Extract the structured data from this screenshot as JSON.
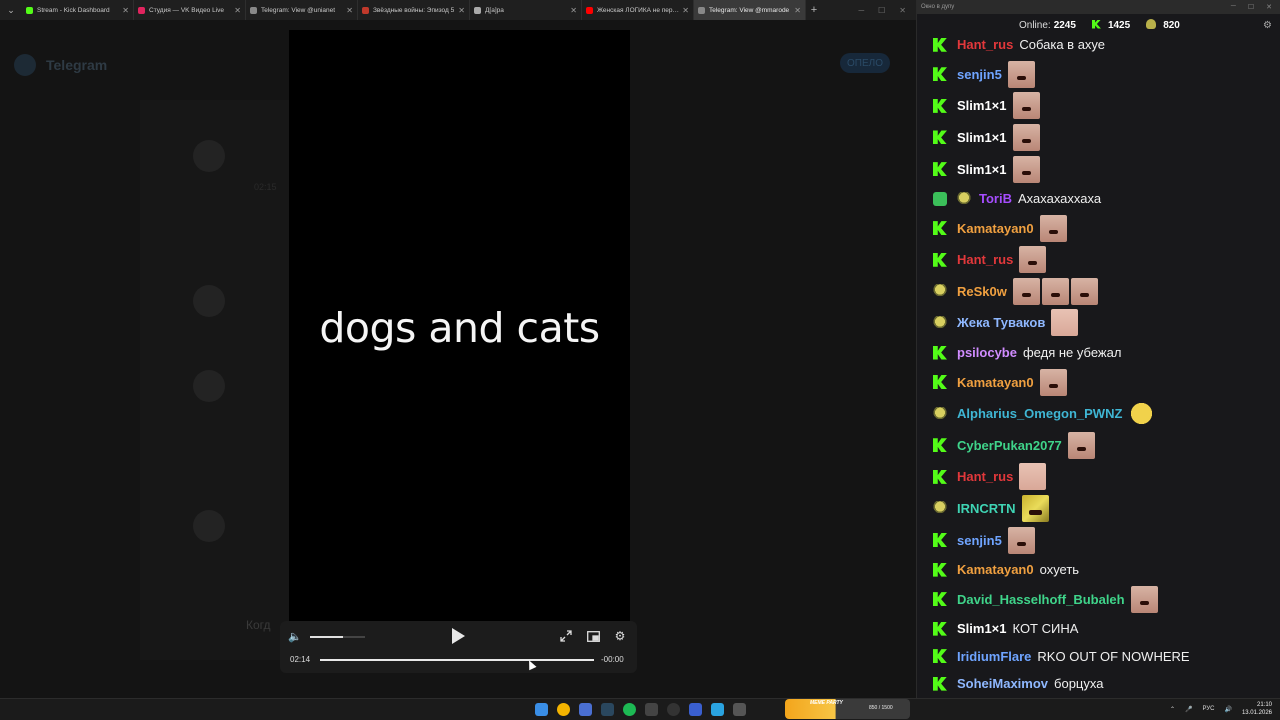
{
  "browser": {
    "tabs": [
      {
        "label": "Stream - Kick Dashboard",
        "color": "#53fc18",
        "active": false
      },
      {
        "label": "Студия — VK Видео Live",
        "color": "#e0245e",
        "active": false
      },
      {
        "label": "Telegram: View @unianet",
        "color": "#888888",
        "active": false
      },
      {
        "label": "Звёздные войны: Эпизод 5",
        "color": "#c0392b",
        "active": false
      },
      {
        "label": "Д[а]ра",
        "color": "#aaaaaa",
        "active": false
      },
      {
        "label": "Женская ЛОГИКА не перес",
        "color": "#ff0000",
        "active": false
      },
      {
        "label": "Telegram: View @mmarode",
        "color": "#888888",
        "active": true
      }
    ],
    "page_header": "Telegram",
    "page_button": "ОПЕЛО",
    "page_snippet": "02:15",
    "page_caption": "Когд"
  },
  "video": {
    "title_text": "dogs and cats",
    "current_time": "02:14",
    "remaining_time": "-00:00",
    "volume_level": 0.6,
    "progress": 1.0
  },
  "chat": {
    "window_title": "Окно в дупу",
    "online_label": "Online:",
    "online_count": "2245",
    "followers_count": "1425",
    "subs_count": "820",
    "messages": [
      {
        "badge": "k",
        "user": "Hant_rus",
        "color": "#e2383b",
        "text": "Собака в ахуе",
        "emotes": []
      },
      {
        "badge": "k",
        "user": "senjin5",
        "color": "#6fa4ff",
        "text": "",
        "emotes": [
          "face"
        ]
      },
      {
        "badge": "k",
        "user": "Slim1×1",
        "color": "#ffffff",
        "text": "",
        "emotes": [
          "face"
        ]
      },
      {
        "badge": "k",
        "user": "Slim1×1",
        "color": "#ffffff",
        "text": "",
        "emotes": [
          "face"
        ]
      },
      {
        "badge": "k",
        "user": "Slim1×1",
        "color": "#ffffff",
        "text": "",
        "emotes": [
          "face"
        ]
      },
      {
        "badge": "g",
        "badge2": true,
        "user": "ToriB",
        "color": "#a64dff",
        "text": "Ахахахаххаха",
        "emotes": []
      },
      {
        "badge": "k",
        "user": "Kamatayan0",
        "color": "#f0a040",
        "text": "",
        "emotes": [
          "face"
        ]
      },
      {
        "badge": "k",
        "user": "Hant_rus",
        "color": "#e2383b",
        "text": "",
        "emotes": [
          "face"
        ]
      },
      {
        "badge": "s",
        "user": "ReSk0w",
        "color": "#f0a040",
        "text": "",
        "emotes": [
          "face",
          "face",
          "face"
        ]
      },
      {
        "badge": "s",
        "user": "Жека Туваков",
        "color": "#8fb8ff",
        "text": "",
        "emotes": [
          "pale"
        ]
      },
      {
        "badge": "k",
        "user": "psilocybe",
        "color": "#d08cff",
        "text": "федя не убежал",
        "emotes": []
      },
      {
        "badge": "k",
        "user": "Kamatayan0",
        "color": "#f0a040",
        "text": "",
        "emotes": [
          "face"
        ]
      },
      {
        "badge": "s",
        "user": "Alpharius_Omegon_PWNZ",
        "color": "#3fb6d4",
        "text": "",
        "emotes": [
          "ball"
        ]
      },
      {
        "badge": "k",
        "user": "CyberPukan2077",
        "color": "#3fd48a",
        "text": "",
        "emotes": [
          "face"
        ]
      },
      {
        "badge": "k",
        "user": "Hant_rus",
        "color": "#e2383b",
        "text": "",
        "emotes": [
          "pale"
        ]
      },
      {
        "badge": "s",
        "user": "IRNCRTN",
        "color": "#3fd4b4",
        "text": "",
        "emotes": [
          "yellow"
        ]
      },
      {
        "badge": "k",
        "user": "senjin5",
        "color": "#6fa4ff",
        "text": "",
        "emotes": [
          "face"
        ]
      },
      {
        "badge": "k",
        "user": "Kamatayan0",
        "color": "#f0a040",
        "text": "охуеть",
        "emotes": []
      },
      {
        "badge": "k",
        "user": "David_Hasselhoff_Bubaleh",
        "color": "#3fd48a",
        "text": "",
        "emotes": [
          "face"
        ]
      },
      {
        "badge": "k",
        "user": "Slim1×1",
        "color": "#ffffff",
        "text": "КОТ СИНА",
        "emotes": []
      },
      {
        "badge": "k",
        "user": "IridiumFlare",
        "color": "#6fa4ff",
        "text": "RKO OUT OF NOWHERE",
        "emotes": []
      },
      {
        "badge": "k",
        "user": "SoheiMaximov",
        "color": "#8fb8ff",
        "text": "борцуха",
        "emotes": []
      }
    ]
  },
  "taskbar": {
    "meme_label": "MEME PARTY",
    "meme_count": "850 / 1500",
    "lang": "РУС",
    "time": "21:10",
    "date": "13.01.2026"
  }
}
